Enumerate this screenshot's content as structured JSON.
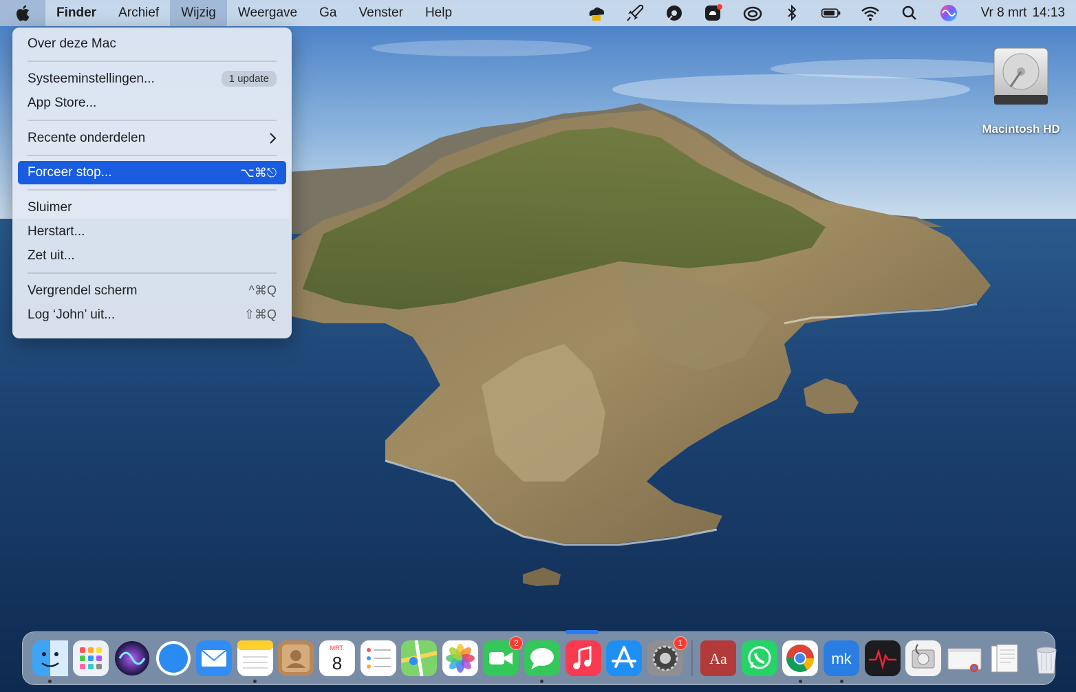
{
  "menubar": {
    "items": [
      {
        "label": "Finder",
        "bold": true
      },
      {
        "label": "Archief"
      },
      {
        "label": "Wijzig"
      },
      {
        "label": "Weergave"
      },
      {
        "label": "Ga"
      },
      {
        "label": "Venster"
      },
      {
        "label": "Help"
      }
    ],
    "status_icons": [
      "cloud-sync-icon",
      "rocket-icon",
      "disk-icon",
      "notification-app-icon",
      "creative-cloud-icon",
      "bluetooth-icon",
      "battery-icon",
      "wifi-icon",
      "search-icon",
      "siri-icon"
    ],
    "clock": {
      "day": "Vr 8 mrt",
      "time": "14:13"
    }
  },
  "apple_menu": {
    "groups": [
      [
        {
          "label": "Over deze Mac"
        }
      ],
      [
        {
          "label": "Systeeminstellingen...",
          "badge": "1 update"
        },
        {
          "label": "App Store..."
        }
      ],
      [
        {
          "label": "Recente onderdelen",
          "submenu": true
        }
      ],
      [
        {
          "label": "Forceer stop...",
          "shortcut": "⌥⌘⎋",
          "highlighted": true
        }
      ],
      [
        {
          "label": "Sluimer"
        },
        {
          "label": "Herstart..."
        },
        {
          "label": "Zet uit..."
        }
      ],
      [
        {
          "label": "Vergrendel scherm",
          "shortcut": "^⌘Q"
        },
        {
          "label": "Log ‘John’ uit...",
          "shortcut": "⇧⌘Q"
        }
      ]
    ]
  },
  "desktop": {
    "drive_label": "Macintosh HD"
  },
  "dock": {
    "apps": [
      {
        "name": "finder",
        "running": true
      },
      {
        "name": "launchpad"
      },
      {
        "name": "siri"
      },
      {
        "name": "safari"
      },
      {
        "name": "mail"
      },
      {
        "name": "notes",
        "running": true
      },
      {
        "name": "contacts"
      },
      {
        "name": "calendar",
        "month": "MRT.",
        "day": "8"
      },
      {
        "name": "reminders"
      },
      {
        "name": "maps"
      },
      {
        "name": "photos"
      },
      {
        "name": "facetime",
        "badge": "2"
      },
      {
        "name": "messages",
        "running": true
      },
      {
        "name": "music"
      },
      {
        "name": "app-store"
      },
      {
        "name": "system-settings",
        "badge": "1"
      },
      {
        "name": "dictionary",
        "text": "Aa"
      },
      {
        "name": "whatsapp"
      },
      {
        "name": "chrome",
        "running": true
      },
      {
        "name": "mk-app",
        "text": "mk",
        "running": true
      },
      {
        "name": "activity-monitor"
      },
      {
        "name": "disk-utility"
      },
      {
        "name": "chrome-window"
      },
      {
        "name": "documents-stack"
      },
      {
        "name": "trash"
      }
    ]
  },
  "colors": {
    "highlight": "#1a5ce0",
    "badge_red": "#ff3b30",
    "menubar": "#d0deee"
  }
}
